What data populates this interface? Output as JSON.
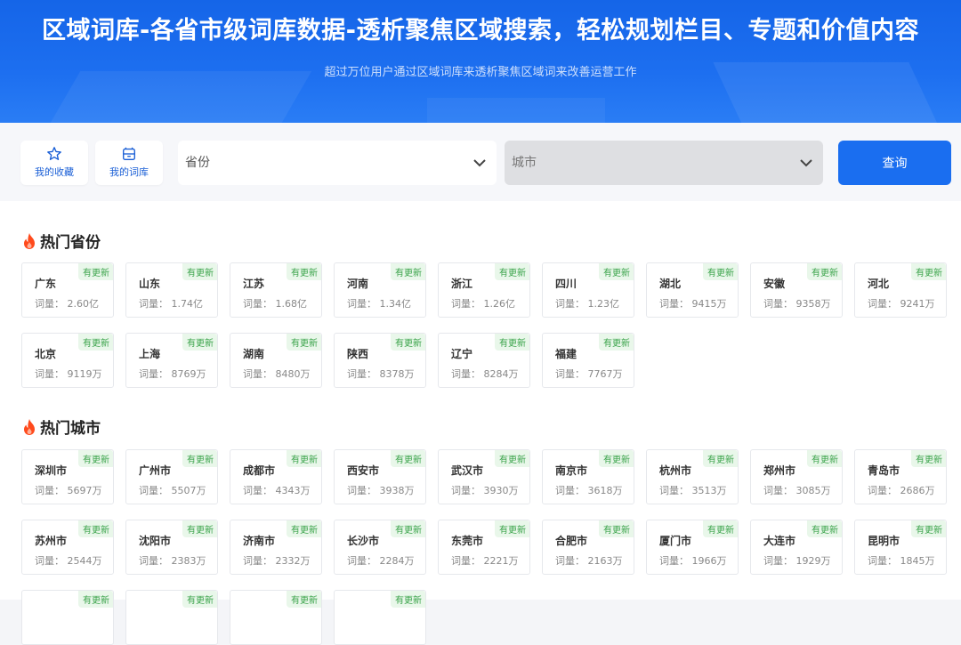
{
  "hero": {
    "title": "区域词库-各省市级词库数据-透析聚焦区域搜索，轻松规划栏目、专题和价值内容",
    "subtitle": "超过万位用户通过区域词库来透析聚焦区域词来改善运营工作"
  },
  "toolbar": {
    "favorites_label": "我的收藏",
    "library_label": "我的词库",
    "province_placeholder": "省份",
    "city_placeholder": "城市",
    "query_label": "查询"
  },
  "colors": {
    "brand": "#1a6ef0",
    "badge_text": "#3aa34a",
    "fire": "#ff4a1c"
  },
  "provinces": {
    "title": "热门省份",
    "badge": "有更新",
    "count_prefix": "词量：",
    "items": [
      {
        "name": "广东",
        "count": "2.60亿"
      },
      {
        "name": "山东",
        "count": "1.74亿"
      },
      {
        "name": "江苏",
        "count": "1.68亿"
      },
      {
        "name": "河南",
        "count": "1.34亿"
      },
      {
        "name": "浙江",
        "count": "1.26亿"
      },
      {
        "name": "四川",
        "count": "1.23亿"
      },
      {
        "name": "湖北",
        "count": "9415万"
      },
      {
        "name": "安徽",
        "count": "9358万"
      },
      {
        "name": "河北",
        "count": "9241万"
      },
      {
        "name": "北京",
        "count": "9119万"
      },
      {
        "name": "上海",
        "count": "8769万"
      },
      {
        "name": "湖南",
        "count": "8480万"
      },
      {
        "name": "陕西",
        "count": "8378万"
      },
      {
        "name": "辽宁",
        "count": "8284万"
      },
      {
        "name": "福建",
        "count": "7767万"
      }
    ]
  },
  "cities": {
    "title": "热门城市",
    "badge": "有更新",
    "count_prefix": "词量：",
    "items": [
      {
        "name": "深圳市",
        "count": "5697万"
      },
      {
        "name": "广州市",
        "count": "5507万"
      },
      {
        "name": "成都市",
        "count": "4343万"
      },
      {
        "name": "西安市",
        "count": "3938万"
      },
      {
        "name": "武汉市",
        "count": "3930万"
      },
      {
        "name": "南京市",
        "count": "3618万"
      },
      {
        "name": "杭州市",
        "count": "3513万"
      },
      {
        "name": "郑州市",
        "count": "3085万"
      },
      {
        "name": "青岛市",
        "count": "2686万"
      },
      {
        "name": "苏州市",
        "count": "2544万"
      },
      {
        "name": "沈阳市",
        "count": "2383万"
      },
      {
        "name": "济南市",
        "count": "2332万"
      },
      {
        "name": "长沙市",
        "count": "2284万"
      },
      {
        "name": "东莞市",
        "count": "2221万"
      },
      {
        "name": "合肥市",
        "count": "2163万"
      },
      {
        "name": "厦门市",
        "count": "1966万"
      },
      {
        "name": "大连市",
        "count": "1929万"
      },
      {
        "name": "昆明市",
        "count": "1845万"
      }
    ],
    "partial_row_badges": 4
  }
}
